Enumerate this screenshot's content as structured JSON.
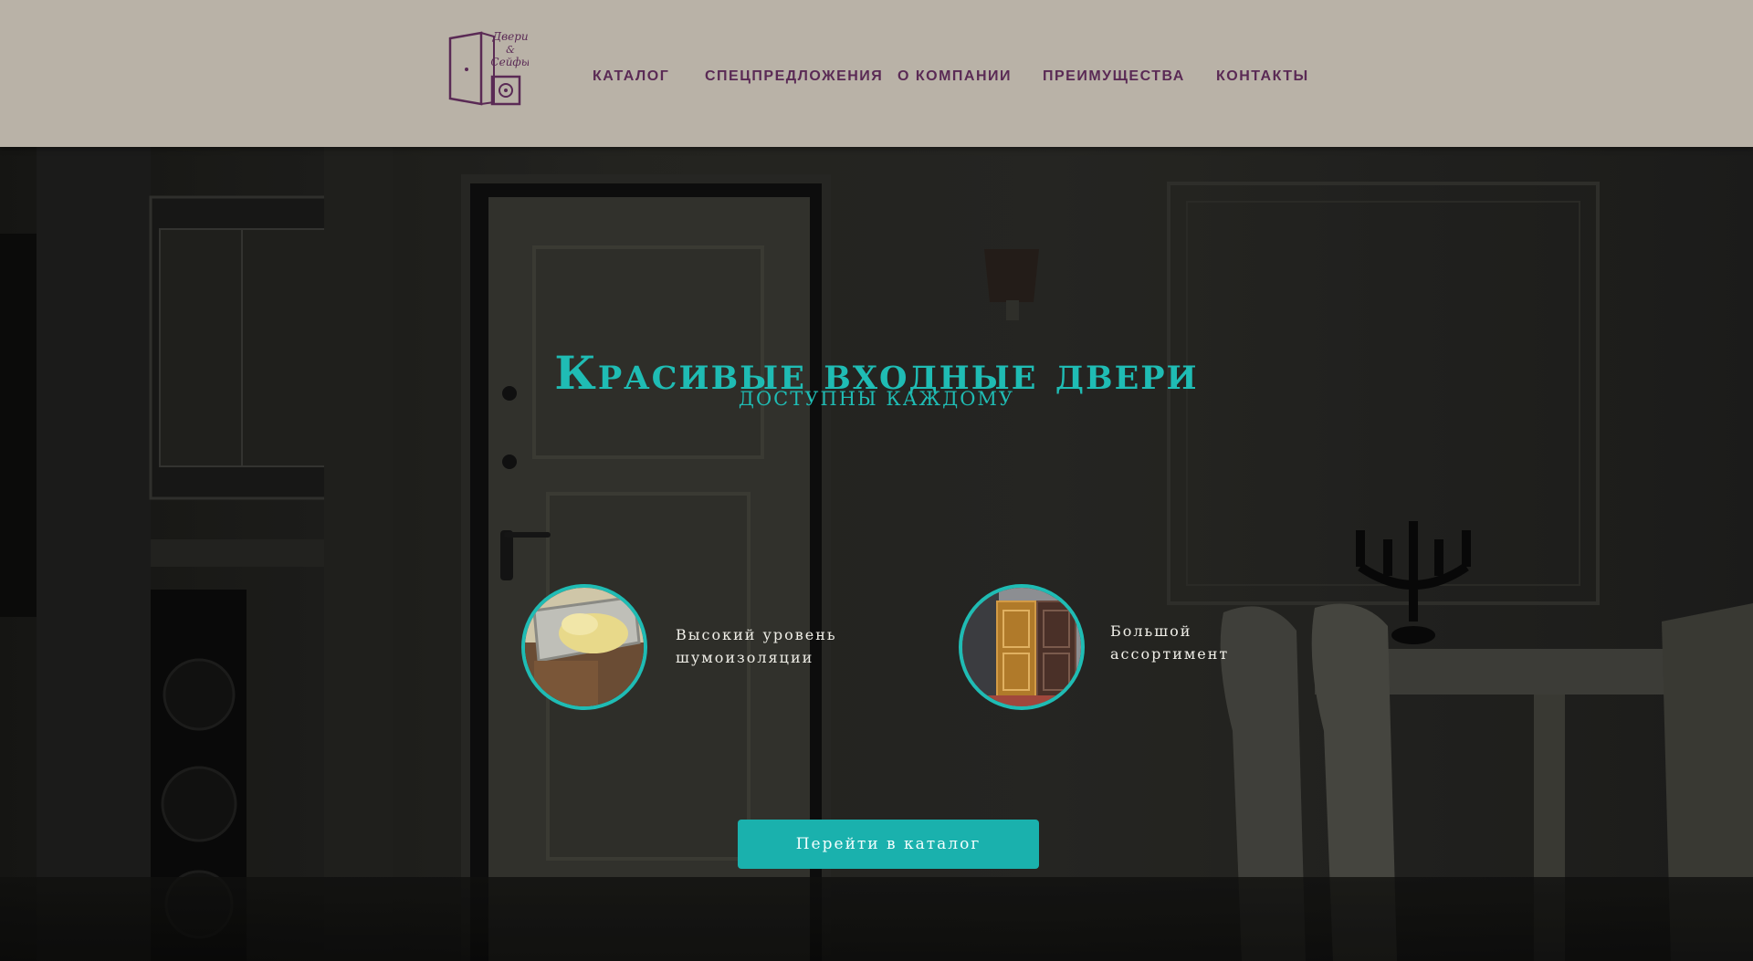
{
  "logo": {
    "text_line1": "Двери",
    "text_line2": "&",
    "text_line3": "Сейфы"
  },
  "nav": {
    "items": [
      {
        "label": "КАТАЛОГ"
      },
      {
        "label": "СПЕЦПРЕДЛОЖЕНИЯ"
      },
      {
        "label": "О КОМПАНИИ"
      },
      {
        "label": "ПРЕИМУЩЕСТВА"
      },
      {
        "label": "КОНТАКТЫ"
      }
    ]
  },
  "hero": {
    "title": "Красивые входные двери",
    "subtitle": "доступны каждому"
  },
  "features": [
    {
      "line1": "Высокий уровень",
      "line2": "шумоизоляции"
    },
    {
      "line1": "Большой",
      "line2": "ассортимент"
    }
  ],
  "cta": {
    "label": "Перейти в каталог"
  },
  "colors": {
    "accent": "#1fbcb4",
    "nav_text": "#5a2a55",
    "header_bg": "#b9b2a7",
    "button_bg": "#1ab1ad"
  }
}
